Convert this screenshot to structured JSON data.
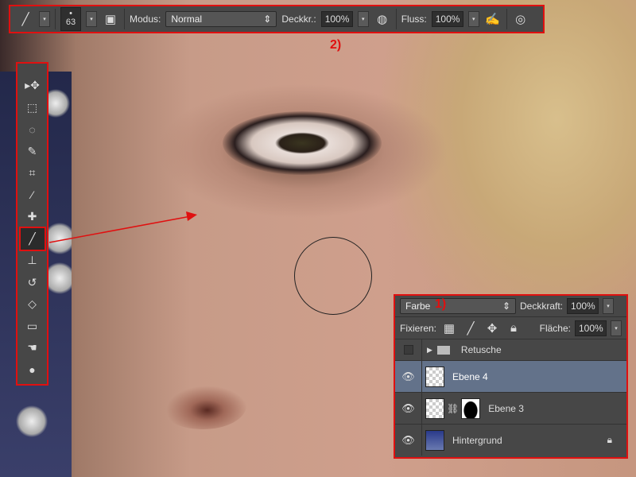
{
  "options_bar": {
    "tool_icon": "brush-icon",
    "brush_size": "63",
    "mode_label": "Modus:",
    "mode_value": "Normal",
    "opacity_label": "Deckkr.:",
    "opacity_value": "100%",
    "flow_label": "Fluss:",
    "flow_value": "100%",
    "annotation": "2)"
  },
  "tools": [
    {
      "icon": "move-icon",
      "glyph": "▸✥"
    },
    {
      "icon": "marquee-icon",
      "glyph": "⬚"
    },
    {
      "icon": "lasso-icon",
      "glyph": "◌"
    },
    {
      "icon": "quick-selection-icon",
      "glyph": "✎"
    },
    {
      "icon": "crop-icon",
      "glyph": "⌗"
    },
    {
      "icon": "eyedropper-icon",
      "glyph": "⁄"
    },
    {
      "icon": "healing-brush-icon",
      "glyph": "✚"
    },
    {
      "icon": "brush-icon",
      "glyph": "╱",
      "active": true
    },
    {
      "icon": "clone-stamp-icon",
      "glyph": "⊥"
    },
    {
      "icon": "history-brush-icon",
      "glyph": "↺"
    },
    {
      "icon": "eraser-icon",
      "glyph": "◇"
    },
    {
      "icon": "gradient-icon",
      "glyph": "▭"
    },
    {
      "icon": "smudge-icon",
      "glyph": "☚"
    },
    {
      "icon": "dodge-icon",
      "glyph": "●"
    }
  ],
  "layers_panel": {
    "blend_mode": "Farbe",
    "annotation": "1)",
    "opacity_label": "Deckkraft:",
    "opacity_value": "100%",
    "lock_label": "Fixieren:",
    "fill_label": "Fläche:",
    "fill_value": "100%",
    "layers": [
      {
        "name": "Retusche",
        "type": "group",
        "visible": false
      },
      {
        "name": "Ebene 4",
        "selected": true,
        "visible": true
      },
      {
        "name": "Ebene 3",
        "mask": true,
        "visible": true
      },
      {
        "name": "Hintergrund",
        "locked": true,
        "visible": true
      }
    ]
  },
  "colors": {
    "highlight": "#e01010",
    "panel": "#474747",
    "selected_layer": "#63728a"
  }
}
